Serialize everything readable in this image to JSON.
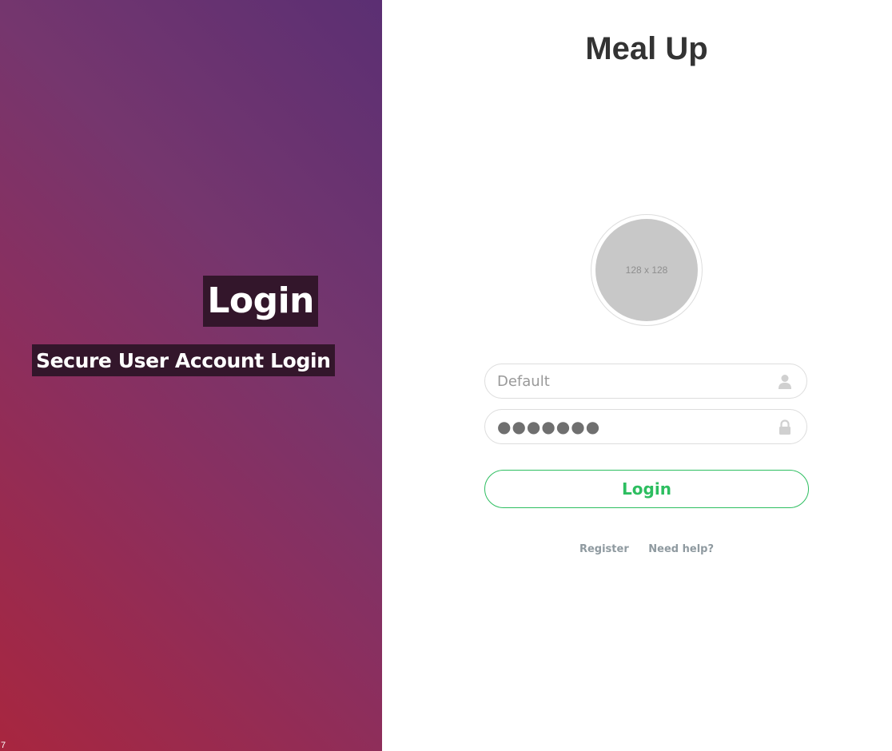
{
  "left": {
    "title": "Login",
    "subtitle": "Secure User Account Login",
    "corner_text": "7"
  },
  "brand": {
    "title": "Meal Up"
  },
  "avatar": {
    "placeholder_text": "128 x 128"
  },
  "form": {
    "username": {
      "placeholder": "Default",
      "value": "",
      "icon": "user-icon"
    },
    "password": {
      "value": "●●●●●●●",
      "icon": "lock-icon"
    },
    "login_label": "Login"
  },
  "links": {
    "register": "Register",
    "help": "Need help?"
  },
  "colors": {
    "accent_green": "#2dbe60",
    "gradient_start": "#a8263f",
    "gradient_end": "#5b2f73",
    "label_bg": "#33162b"
  }
}
